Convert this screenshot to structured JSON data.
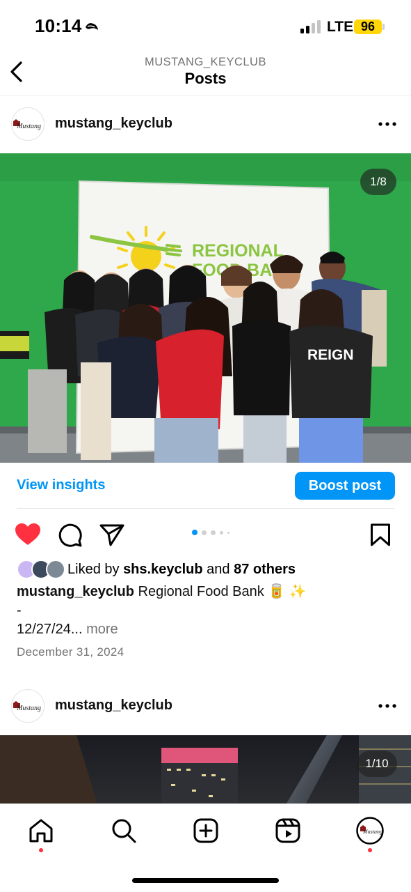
{
  "status_bar": {
    "time": "10:14",
    "network": "LTE",
    "battery": "96",
    "signal_bars_active": 2,
    "signal_bars_total": 4
  },
  "header": {
    "subtitle": "MUSTANG_KEYCLUB",
    "title": "Posts"
  },
  "post1": {
    "username": "mustang_keyclub",
    "avatar_logo": "Mustang",
    "counter": "1/8",
    "photo_banner_line1": "REGIONAL",
    "photo_banner_line2": "FOOD BANK",
    "photo_shirt_text": "REIGN",
    "insights_label": "View insights",
    "boost_label": "Boost post",
    "likes_prefix": "Liked by",
    "likes_user": "shs.keyclub",
    "likes_and": "and",
    "likes_others": "87 others",
    "caption_user": "mustang_keyclub",
    "caption_text": "Regional Food Bank 🥫 ✨",
    "caption_line2": "-",
    "caption_line3": "12/27/24...",
    "more_label": "more",
    "date": "December 31, 2024",
    "carousel_dots": 5,
    "carousel_active": 1
  },
  "post2": {
    "username": "mustang_keyclub",
    "avatar_logo": "Mustang",
    "counter": "1/10"
  },
  "colors": {
    "accent_blue": "#0095f6",
    "like_red": "#ff3040",
    "battery_yellow": "#ffd60a",
    "wall_green": "#2ea84a"
  },
  "icons": {
    "back": "chevron-left-icon",
    "more": "more-horizontal-icon",
    "like": "heart-filled-icon",
    "comment": "comment-icon",
    "share": "send-icon",
    "save": "bookmark-icon",
    "tabs": [
      "home-icon",
      "search-icon",
      "create-icon",
      "reels-icon",
      "profile-avatar"
    ]
  }
}
